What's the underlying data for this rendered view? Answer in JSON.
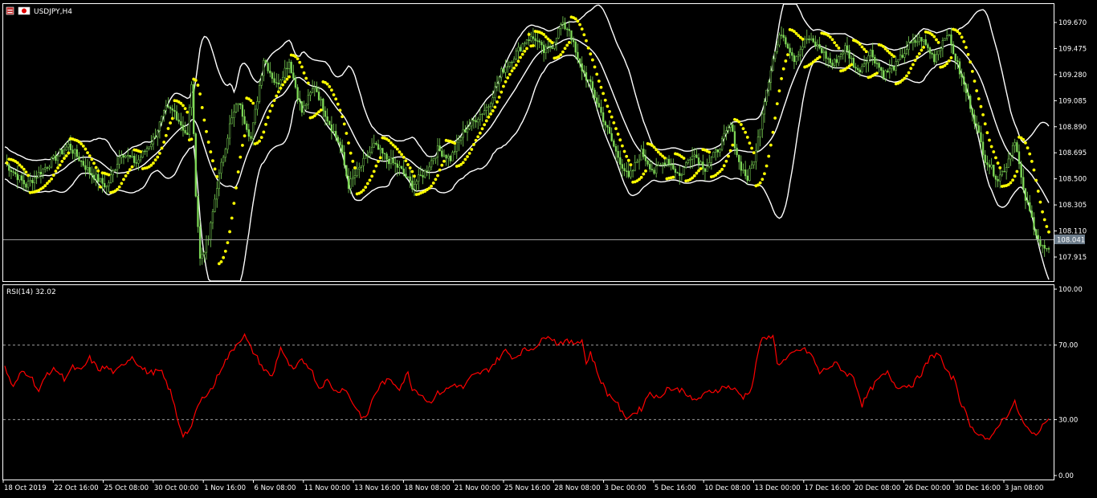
{
  "window": {
    "title": "USDJPY,H4",
    "current_price": "108.041"
  },
  "colors": {
    "background": "#000000",
    "frame": "#ffffff",
    "bull_candle": "#7ed957",
    "bear_candle": "#7ed957",
    "bollinger": "#ffffff",
    "parabolic_sar": "#ffff00",
    "rsi_line": "#ff0000",
    "level_line": "#9a9a9a"
  },
  "chart_data": [
    {
      "type": "candlestick",
      "title": "USDJPY,H4",
      "indicators": [
        "Bollinger Bands",
        "Parabolic SAR"
      ],
      "ylim": [
        107.82,
        109.82
      ],
      "y_ticks": [
        "109.670",
        "109.475",
        "109.280",
        "109.085",
        "108.890",
        "108.695",
        "108.500",
        "108.305",
        "108.110",
        "107.915"
      ],
      "x_ticks": [
        "18 Oct 2019",
        "22 Oct 16:00",
        "25 Oct 08:00",
        "30 Oct 00:00",
        "1 Nov 16:00",
        "6 Nov 08:00",
        "11 Nov 00:00",
        "13 Nov 16:00",
        "18 Nov 08:00",
        "21 Nov 00:00",
        "25 Nov 16:00",
        "28 Nov 08:00",
        "3 Dec 00:00",
        "5 Dec 16:00",
        "10 Dec 08:00",
        "13 Dec 00:00",
        "17 Dec 16:00",
        "20 Dec 08:00",
        "26 Dec 00:00",
        "30 Dec 16:00",
        "3 Jan 08:00"
      ],
      "current_price": 108.041,
      "close_path": [
        [
          0,
          108.62
        ],
        [
          10,
          108.45
        ],
        [
          20,
          108.6
        ],
        [
          30,
          108.75
        ],
        [
          40,
          108.55
        ],
        [
          48,
          108.44
        ],
        [
          55,
          108.7
        ],
        [
          62,
          108.62
        ],
        [
          70,
          108.8
        ],
        [
          76,
          109.02
        ],
        [
          80,
          109.0
        ],
        [
          86,
          108.82
        ],
        [
          88,
          109.22
        ],
        [
          90,
          108.4
        ],
        [
          92,
          107.9
        ],
        [
          96,
          108.05
        ],
        [
          100,
          108.45
        ],
        [
          106,
          108.9
        ],
        [
          110,
          109.08
        ],
        [
          116,
          108.8
        ],
        [
          122,
          109.4
        ],
        [
          128,
          109.2
        ],
        [
          134,
          109.38
        ],
        [
          140,
          109.0
        ],
        [
          146,
          109.2
        ],
        [
          152,
          108.95
        ],
        [
          158,
          108.75
        ],
        [
          162,
          108.45
        ],
        [
          168,
          108.6
        ],
        [
          174,
          108.75
        ],
        [
          180,
          108.65
        ],
        [
          186,
          108.58
        ],
        [
          192,
          108.45
        ],
        [
          198,
          108.55
        ],
        [
          204,
          108.72
        ],
        [
          210,
          108.65
        ],
        [
          216,
          108.85
        ],
        [
          222,
          108.95
        ],
        [
          228,
          109.05
        ],
        [
          234,
          109.3
        ],
        [
          240,
          109.42
        ],
        [
          246,
          109.55
        ],
        [
          250,
          109.55
        ],
        [
          254,
          109.45
        ],
        [
          258,
          109.5
        ],
        [
          262,
          109.65
        ],
        [
          266,
          109.62
        ],
        [
          270,
          109.38
        ],
        [
          276,
          109.2
        ],
        [
          282,
          108.95
        ],
        [
          288,
          108.7
        ],
        [
          294,
          108.5
        ],
        [
          300,
          108.7
        ],
        [
          306,
          108.55
        ],
        [
          312,
          108.65
        ],
        [
          318,
          108.52
        ],
        [
          324,
          108.7
        ],
        [
          330,
          108.58
        ],
        [
          336,
          108.72
        ],
        [
          342,
          108.9
        ],
        [
          346,
          108.62
        ],
        [
          350,
          108.5
        ],
        [
          354,
          108.7
        ],
        [
          358,
          109.1
        ],
        [
          362,
          109.4
        ],
        [
          366,
          109.6
        ],
        [
          372,
          109.4
        ],
        [
          378,
          109.55
        ],
        [
          384,
          109.48
        ],
        [
          390,
          109.35
        ],
        [
          396,
          109.48
        ],
        [
          402,
          109.3
        ],
        [
          408,
          109.45
        ],
        [
          414,
          109.28
        ],
        [
          420,
          109.35
        ],
        [
          426,
          109.5
        ],
        [
          432,
          109.55
        ],
        [
          438,
          109.4
        ],
        [
          444,
          109.6
        ],
        [
          450,
          109.3
        ],
        [
          456,
          109.0
        ],
        [
          462,
          108.65
        ],
        [
          468,
          108.5
        ],
        [
          472,
          108.6
        ],
        [
          476,
          108.8
        ],
        [
          480,
          108.4
        ],
        [
          484,
          108.2
        ],
        [
          488,
          108.0
        ],
        [
          492,
          107.95
        ]
      ]
    },
    {
      "type": "line",
      "title": "RSI(14) 32.02",
      "ylim": [
        0,
        100
      ],
      "y_ticks": [
        "100.00",
        "70.00",
        "30.00",
        "0.00"
      ],
      "levels": [
        70,
        30
      ],
      "series": [
        {
          "name": "RSI(14)",
          "points": [
            [
              0,
              58
            ],
            [
              4,
              47
            ],
            [
              8,
              56
            ],
            [
              12,
              54
            ],
            [
              16,
              45
            ],
            [
              20,
              55
            ],
            [
              24,
              57
            ],
            [
              28,
              52
            ],
            [
              32,
              58
            ],
            [
              36,
              56
            ],
            [
              40,
              63
            ],
            [
              44,
              57
            ],
            [
              48,
              58
            ],
            [
              52,
              55
            ],
            [
              56,
              60
            ],
            [
              60,
              64
            ],
            [
              64,
              58
            ],
            [
              68,
              55
            ],
            [
              72,
              56
            ],
            [
              74,
              55
            ],
            [
              78,
              45
            ],
            [
              80,
              37
            ],
            [
              82,
              28
            ],
            [
              84,
              22
            ],
            [
              88,
              25
            ],
            [
              90,
              35
            ],
            [
              94,
              43
            ],
            [
              98,
              47
            ],
            [
              102,
              58
            ],
            [
              106,
              65
            ],
            [
              110,
              72
            ],
            [
              113,
              75
            ],
            [
              116,
              68
            ],
            [
              118,
              65
            ],
            [
              122,
              57
            ],
            [
              126,
              53
            ],
            [
              130,
              69
            ],
            [
              132,
              63
            ],
            [
              136,
              56
            ],
            [
              140,
              62
            ],
            [
              144,
              58
            ],
            [
              148,
              47
            ],
            [
              152,
              51
            ],
            [
              156,
              45
            ],
            [
              160,
              47
            ],
            [
              164,
              39
            ],
            [
              168,
              32
            ],
            [
              170,
              30
            ],
            [
              174,
              43
            ],
            [
              178,
              50
            ],
            [
              182,
              51
            ],
            [
              186,
              47
            ],
            [
              190,
              55
            ],
            [
              192,
              47
            ],
            [
              196,
              44
            ],
            [
              200,
              39
            ],
            [
              204,
              44
            ],
            [
              208,
              46
            ],
            [
              212,
              49
            ],
            [
              216,
              47
            ],
            [
              220,
              53
            ],
            [
              224,
              55
            ],
            [
              228,
              57
            ],
            [
              232,
              62
            ],
            [
              236,
              67
            ],
            [
              240,
              63
            ],
            [
              244,
              67
            ],
            [
              248,
              68
            ],
            [
              252,
              71
            ],
            [
              256,
              76
            ],
            [
              260,
              71
            ],
            [
              264,
              72
            ],
            [
              268,
              71
            ],
            [
              272,
              73
            ],
            [
              274,
              60
            ],
            [
              276,
              66
            ],
            [
              280,
              53
            ],
            [
              284,
              44
            ],
            [
              288,
              40
            ],
            [
              292,
              31
            ],
            [
              296,
              33
            ],
            [
              300,
              36
            ],
            [
              304,
              45
            ],
            [
              308,
              41
            ],
            [
              312,
              47
            ],
            [
              316,
              46
            ],
            [
              320,
              46
            ],
            [
              324,
              40
            ],
            [
              328,
              42
            ],
            [
              332,
              45
            ],
            [
              336,
              46
            ],
            [
              340,
              48
            ],
            [
              344,
              46
            ],
            [
              348,
              42
            ],
            [
              352,
              47
            ],
            [
              356,
              72
            ],
            [
              360,
              74
            ],
            [
              362,
              76
            ],
            [
              364,
              60
            ],
            [
              368,
              62
            ],
            [
              372,
              66
            ],
            [
              376,
              68
            ],
            [
              380,
              65
            ],
            [
              384,
              55
            ],
            [
              388,
              58
            ],
            [
              392,
              60
            ],
            [
              396,
              55
            ],
            [
              400,
              53
            ],
            [
              404,
              38
            ],
            [
              408,
              46
            ],
            [
              412,
              52
            ],
            [
              416,
              55
            ],
            [
              420,
              48
            ],
            [
              424,
              48
            ],
            [
              428,
              49
            ],
            [
              432,
              55
            ],
            [
              436,
              63
            ],
            [
              440,
              66
            ],
            [
              444,
              55
            ],
            [
              448,
              51
            ],
            [
              450,
              41
            ],
            [
              454,
              30
            ],
            [
              456,
              25
            ],
            [
              460,
              22
            ],
            [
              464,
              18
            ],
            [
              468,
              27
            ],
            [
              472,
              32
            ],
            [
              476,
              39
            ],
            [
              480,
              28
            ],
            [
              484,
              22
            ],
            [
              488,
              24
            ],
            [
              492,
              32
            ]
          ]
        }
      ]
    }
  ]
}
